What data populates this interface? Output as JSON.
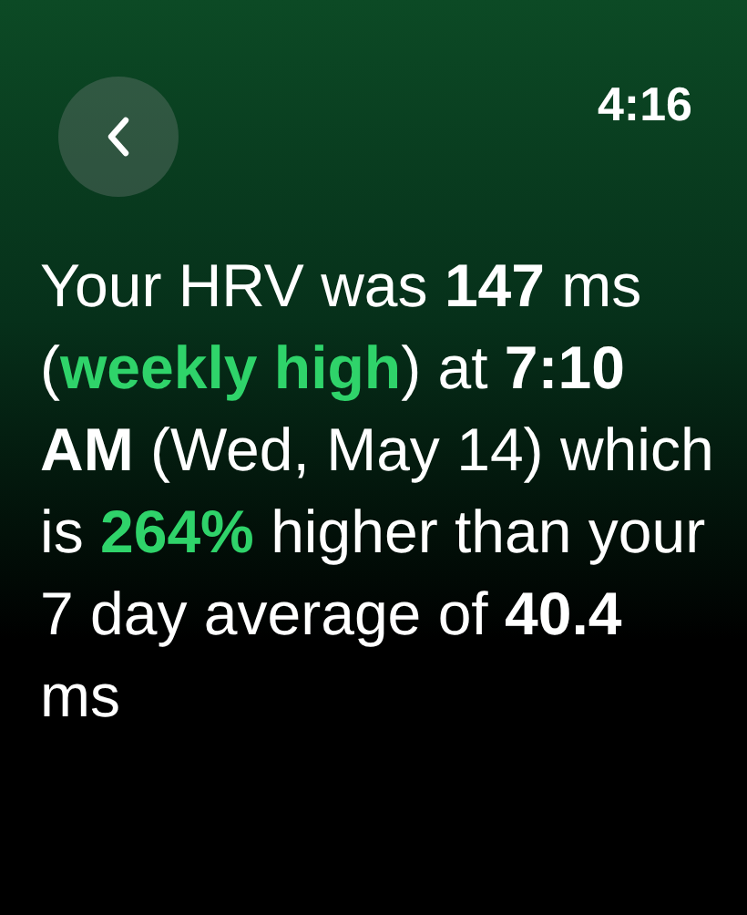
{
  "status_bar": {
    "time": "4:16"
  },
  "message": [
    {
      "kind": "plain",
      "text": "Your HRV was "
    },
    {
      "kind": "bold",
      "text": "147"
    },
    {
      "kind": "plain",
      "text": " ms ("
    },
    {
      "kind": "highlight",
      "text": "weekly high"
    },
    {
      "kind": "plain",
      "text": ") at "
    },
    {
      "kind": "bold",
      "text": "7:10 AM"
    },
    {
      "kind": "plain",
      "text": " (Wed, May 14) which is "
    },
    {
      "kind": "highlight",
      "text": "264%"
    },
    {
      "kind": "plain",
      "text": " higher than your 7 day average of "
    },
    {
      "kind": "bold",
      "text": "40.4"
    },
    {
      "kind": "plain",
      "text": " ms"
    }
  ]
}
